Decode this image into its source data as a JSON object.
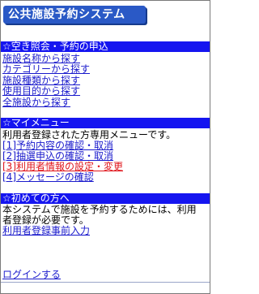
{
  "header": {
    "title": "公共施設予約システム"
  },
  "sections": {
    "search": {
      "heading": "☆空き照会・予約の申込",
      "links": [
        "施設名称から探す",
        "カテゴリーから探す",
        "施設種類から探す",
        "使用目的から探す",
        "全施設から探す"
      ]
    },
    "mymenu": {
      "heading": "☆マイメニュー",
      "description": "利用者登録された方専用メニューです。",
      "links": [
        "[1]予約内容の確認・取消",
        "[2]抽選申込の確認・取消",
        "[3]利用者情報の設定・変更",
        "[4]メッセージの確認"
      ]
    },
    "first_time": {
      "heading": "☆初めての方へ",
      "description_line1": "本システムで施設を予約するためには、利用",
      "description_line2": "者登録が必要です。",
      "link": "利用者登録事前入力"
    }
  },
  "footer": {
    "login_link": "ログインする"
  },
  "colors": {
    "section_bar": "#1515f0",
    "link": "#1a1acc",
    "alert_link": "#e0161c",
    "logo_bg": "#2a59c6"
  }
}
